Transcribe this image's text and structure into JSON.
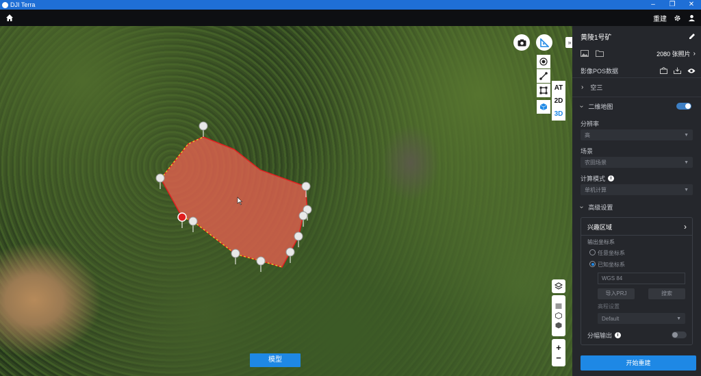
{
  "window": {
    "title": "DJI Terra",
    "minimize": "–",
    "restore": "❐",
    "close": "✕"
  },
  "topbar": {
    "rebuild_label": "重建"
  },
  "map": {
    "model_button": "模型",
    "view_buttons": {
      "at": "AT",
      "two_d": "2D",
      "three_d": "3D"
    },
    "zoom_in": "+",
    "zoom_out": "−",
    "collapse": "»"
  },
  "panel": {
    "project_name": "黄陵1号矿",
    "photo_count": "2080 张照片",
    "pos_label": "影像POS数据",
    "section_aerial": "空三",
    "section_2d_map": "二维地图",
    "resolution_label": "分辨率",
    "resolution_value": "高",
    "scene_label": "场景",
    "scene_value": "农田场景",
    "compute_label": "计算模式",
    "compute_value": "单机计算",
    "advanced_label": "高级设置",
    "roi_label": "兴趣区域",
    "output_cs_label": "输出坐标系",
    "cs_option_any": "任意坐标系",
    "cs_option_known": "已知坐标系",
    "cs_value": "WGS 84",
    "import_prj": "导入PRJ",
    "search": "搜索",
    "elevation_label": "高程设置",
    "elevation_value": "Default",
    "tile_output_label": "分幅输出",
    "start_button": "开始重建"
  },
  "colors": {
    "accent": "#1e88e5",
    "titlebar": "#1f6fd6",
    "region_fill": "#e5604f",
    "region_edge": "#e02020",
    "region_dash": "#e6c52b"
  }
}
